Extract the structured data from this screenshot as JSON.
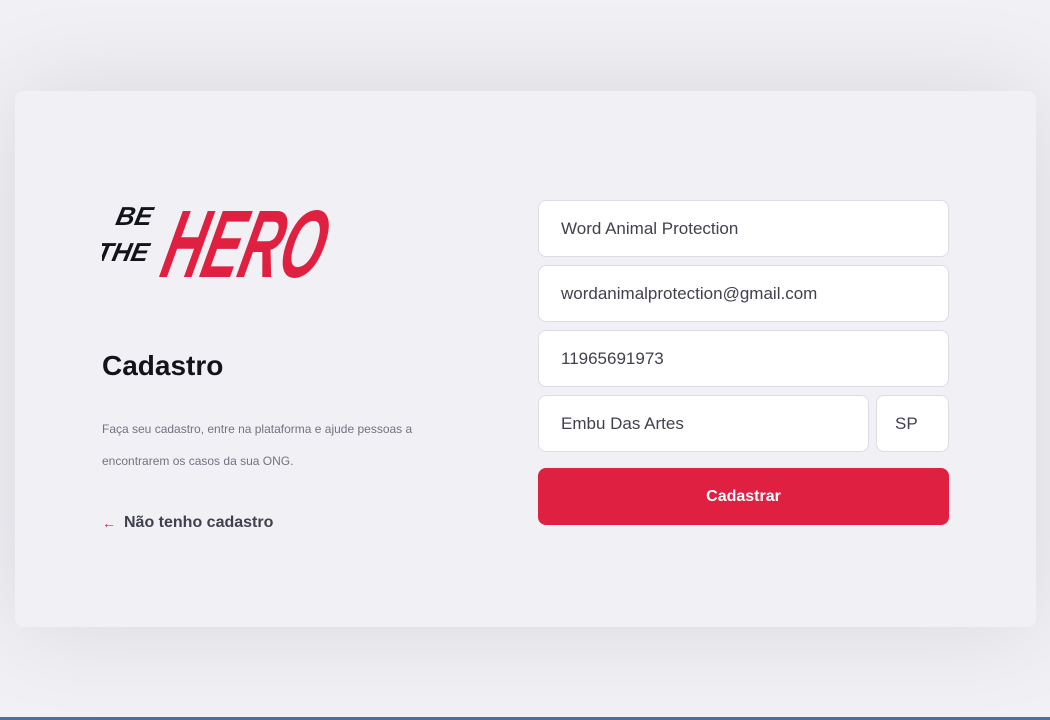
{
  "logo": {
    "text_small_top": "BE",
    "text_small_bottom": "THE",
    "text_large": "HERO",
    "colors": {
      "primary": "#e02041",
      "dark": "#13131a"
    }
  },
  "register": {
    "title": "Cadastro",
    "description": "Faça seu cadastro, entre na plataforma e ajude pessoas a encontrarem os casos da sua ONG.",
    "back_link": {
      "icon": "arrow-left-icon",
      "label": "Não tenho cadastro"
    }
  },
  "form": {
    "name": {
      "value": "Word Animal Protection",
      "placeholder": "Nome da ONG"
    },
    "email": {
      "value": "wordanimalprotection@gmail.com",
      "placeholder": "E-mail"
    },
    "whatsapp": {
      "value": "11965691973",
      "placeholder": "WhatsApp"
    },
    "city": {
      "value": "Embu Das Artes",
      "placeholder": "Cidade"
    },
    "uf": {
      "value": "SP",
      "placeholder": "UF"
    },
    "submit_label": "Cadastrar"
  },
  "colors": {
    "accent": "#e02041",
    "background": "#f0f0f5",
    "text_dark": "#13131a",
    "text_muted": "#737380"
  }
}
